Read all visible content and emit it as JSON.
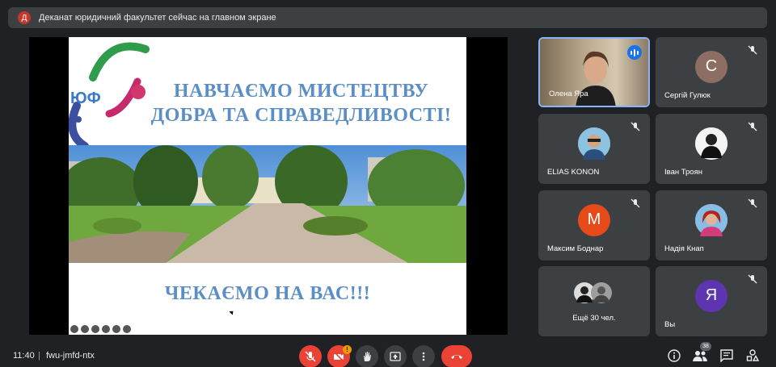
{
  "banner": {
    "avatar_letter": "Д",
    "text": "Деканат юридичний факультет сейчас на главном экране"
  },
  "slide": {
    "logo_text": "ЮФ",
    "title_line1": "НАВЧАЄМО МИСТЕЦТВУ",
    "title_line2": "ДОБРА ТА СПРАВЕДЛИВОСТІ!",
    "subtitle": "ЧЕКАЄМО НА ВАС!!!"
  },
  "participants": [
    {
      "name": "Олена Яра",
      "speaking": true
    },
    {
      "name": "Сергій Гулюк",
      "letter": "С",
      "color": "#8d6e63"
    },
    {
      "name": "ELIAS KONON"
    },
    {
      "name": "Іван Троян"
    },
    {
      "name": "Максим Боднар",
      "letter": "М",
      "color": "#e64a19"
    },
    {
      "name": "Надія Кнап"
    },
    {
      "name": "Ещё 30 чел."
    },
    {
      "name": "Вы",
      "letter": "Я",
      "color": "#5e35b1"
    }
  ],
  "bottombar": {
    "time": "11:40",
    "separator": "|",
    "meeting_code": "fwu-jmfd-ntx",
    "camera_warning": "!",
    "participants_count": "38"
  },
  "colors": {
    "accent": "#8ab4f8",
    "danger": "#ea4335",
    "title_blue": "#5b8ec4"
  }
}
